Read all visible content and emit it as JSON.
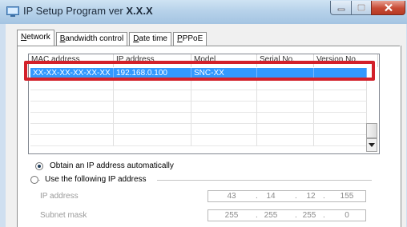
{
  "window": {
    "title_prefix": "IP Setup Program ver",
    "title_version": "X.X.X",
    "buttons": [
      "minimize",
      "maximize",
      "close"
    ]
  },
  "tabs": [
    {
      "label": "Network",
      "mnemonic": "N",
      "rest": "etwork",
      "active": true
    },
    {
      "label": "Bandwidth control",
      "mnemonic": "B",
      "rest": "andwidth control",
      "active": false
    },
    {
      "label": "Date time",
      "mnemonic": "D",
      "rest": "ate time",
      "active": false
    },
    {
      "label": "PPPoE",
      "mnemonic": "P",
      "rest": "PPoE",
      "active": false
    }
  ],
  "device_list": {
    "columns": [
      "MAC address",
      "IP address",
      "Model",
      "Serial No.",
      "Version No."
    ],
    "rows": [
      {
        "mac": "XX-XX-XX-XX-XX-XX",
        "ip": "192.168.0.100",
        "model": "SNC-XX",
        "serial": "",
        "version": "",
        "selected": true
      }
    ],
    "empty_rows": 8
  },
  "ip_settings": {
    "option_auto": "Obtain an IP address automatically",
    "option_manual": "Use the following IP address",
    "selected": "auto",
    "ip_address_label": "IP address",
    "ip_address": [
      "43",
      "14",
      "12",
      "155"
    ],
    "subnet_mask_label": "Subnet mask",
    "subnet_mask": [
      "255",
      "255",
      "255",
      "0"
    ]
  },
  "colors": {
    "selection": "#3399ff",
    "highlight_frame": "#d3202a",
    "close_button": "#c74a34"
  }
}
